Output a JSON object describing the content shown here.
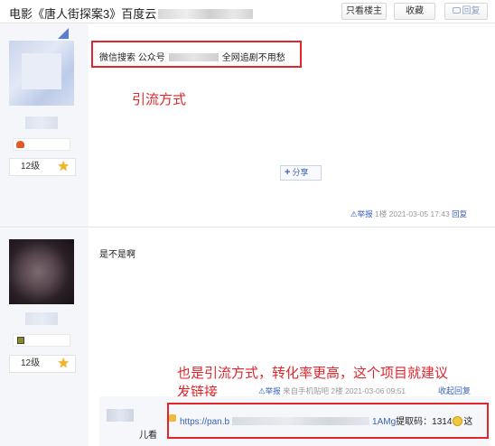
{
  "header": {
    "title": "电影《唐人街探案3》百度云",
    "only_op_label": "只看楼主",
    "favorite_label": "收藏",
    "reply_label": "回复"
  },
  "post1": {
    "level": "12级",
    "content": {
      "prefix": "微信搜索 公众号",
      "suffix": "全网追剧不用愁"
    },
    "annotation": "引流方式",
    "share_label": "分享",
    "report_label": "举报",
    "floor": "1楼",
    "datetime": "2021-03-05 17:43",
    "reply_label": "回复"
  },
  "post2": {
    "level": "12级",
    "content": "是不是啊",
    "annotation_line1": "也是引流方式，转化率更高，这个项目就建议",
    "annotation_line2": "发链接",
    "report_label": "举报",
    "source": "来自手机贴吧",
    "floor": "2楼",
    "datetime": "2021-03-06 09:51",
    "collapse_label": "收起回复",
    "sub_reply": {
      "link_prefix": "https://pan.b",
      "link_suffix": "1AMg",
      "code_label": "提取码：1314",
      "tail": "这",
      "line2": "儿看"
    }
  },
  "colors": {
    "annotation_red": "#e0262b",
    "link_blue": "#3a62b8",
    "sidebar_bg": "#f4f6fa"
  }
}
